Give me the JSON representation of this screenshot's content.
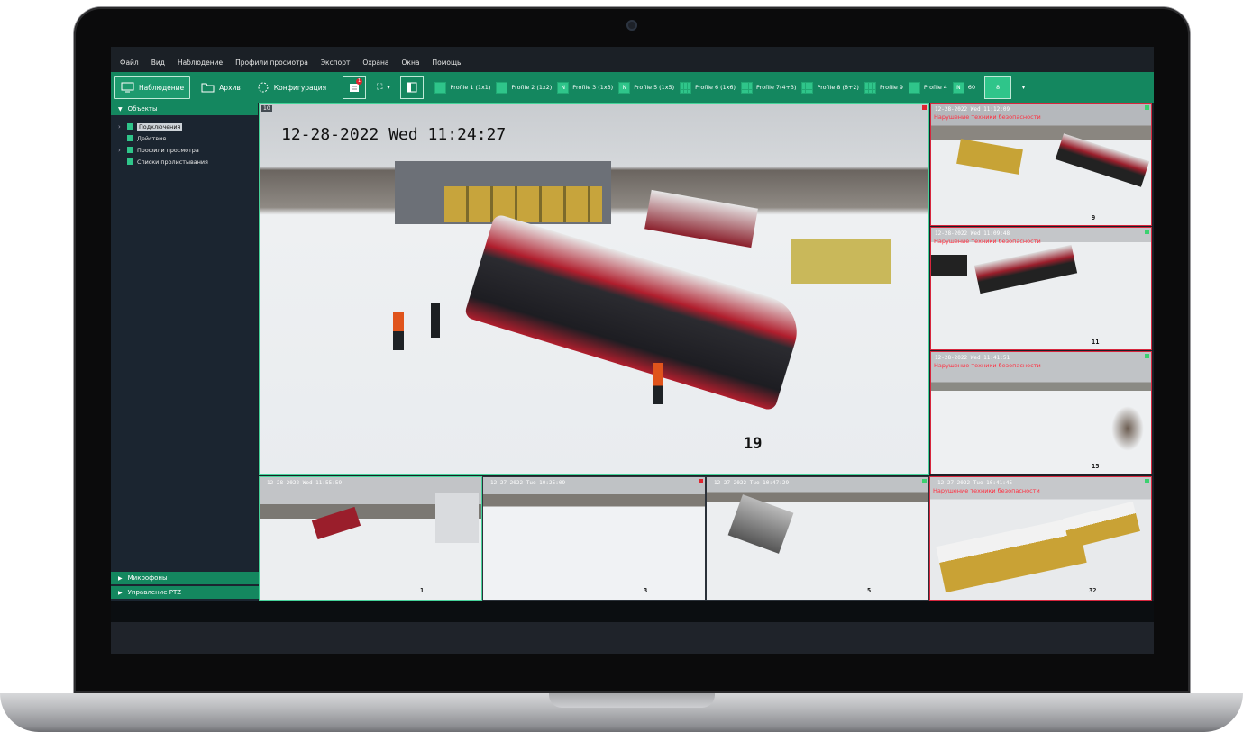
{
  "menu": [
    "Файл",
    "Вид",
    "Наблюдение",
    "Профили просмотра",
    "Экспорт",
    "Охрана",
    "Окна",
    "Помощь"
  ],
  "toolbar": {
    "observe": "Наблюдение",
    "archive": "Архив",
    "config": "Конфигурация",
    "badge": "1",
    "profiles": [
      {
        "label": "Profile 1 (1x1)",
        "icon": "solid"
      },
      {
        "label": "Profile 2 (1x2)",
        "icon": "solid"
      },
      {
        "label": "Profile 3 (1x3)",
        "icon": "N"
      },
      {
        "label": "Profile 5 (1x5)",
        "icon": "N"
      },
      {
        "label": "Profile 6 (1x6)",
        "icon": "grid"
      },
      {
        "label": "Profile 7(4+3)",
        "icon": "grid"
      },
      {
        "label": "Profile 8 (8+2)",
        "icon": "grid"
      },
      {
        "label": "Profile 9",
        "icon": "grid"
      },
      {
        "label": "Profile 4",
        "icon": "solid"
      },
      {
        "label": "60",
        "icon": "N"
      }
    ],
    "current_profile": "8"
  },
  "sidebar": {
    "objects": "Объекты",
    "tree": [
      "Подключения",
      "Действия",
      "Профили просмотра",
      "Списки пролистывания"
    ],
    "microphones": "Микрофоны",
    "ptz": "Управление PTZ"
  },
  "cameras": {
    "main": {
      "index": "10",
      "timestamp": "12-28-2022 Wed 11:24:27",
      "number": "19"
    },
    "r1": {
      "timestamp": "12-28-2022 Wed 11:12:09",
      "alert": "Нарушение техники безопасности",
      "number": "9"
    },
    "r2": {
      "timestamp": "12-28-2022 Wed 11:09:48",
      "alert": "Нарушение техники безопасности",
      "number": "11"
    },
    "r3": {
      "timestamp": "12-28-2022 Wed 11:41:51",
      "alert": "Нарушение техники безопасности",
      "number": "15"
    },
    "b1": {
      "timestamp": "12-28-2022 Wed 11:55:59",
      "number": "1"
    },
    "b2": {
      "timestamp": "12-27-2022 Tue 10:25:09",
      "number": "3"
    },
    "b3": {
      "timestamp": "12-27-2022 Tue 10:47:29",
      "number": "5"
    },
    "b4": {
      "timestamp": "12-27-2022 Tue 10:41:45",
      "alert": "Нарушение техники безопасности",
      "number": "32"
    }
  },
  "colors": {
    "accent": "#14875f",
    "alert": "#d7263d",
    "selected": "#46d39a"
  }
}
